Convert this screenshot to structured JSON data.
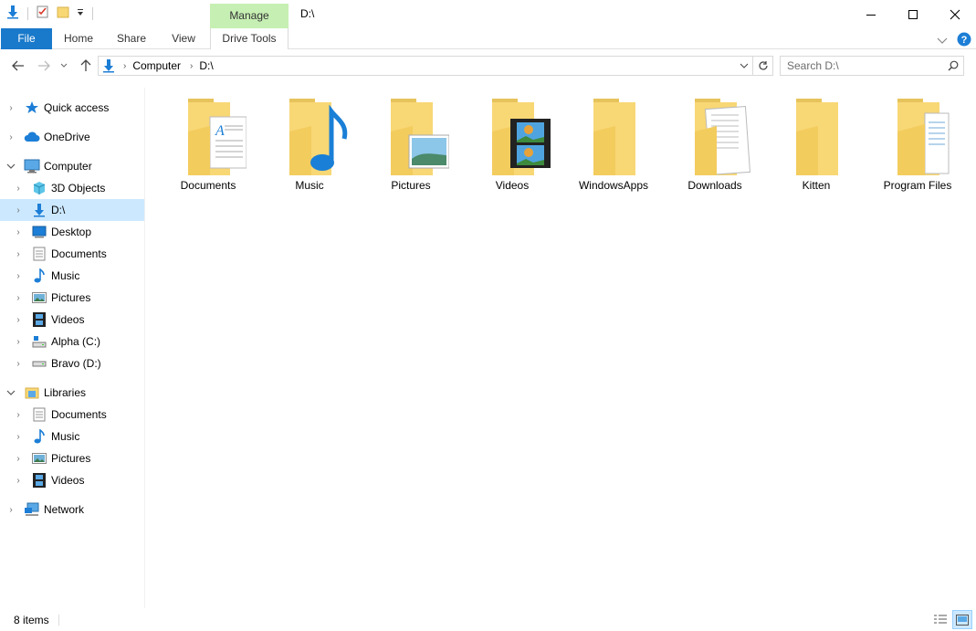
{
  "window": {
    "title": "D:\\",
    "context_tab": "Manage"
  },
  "ribbon": {
    "tabs": [
      "File",
      "Home",
      "Share",
      "View",
      "Drive Tools"
    ]
  },
  "address": {
    "crumbs": [
      "Computer",
      "D:\\"
    ]
  },
  "search": {
    "placeholder": "Search D:\\"
  },
  "nav": {
    "items": [
      {
        "label": "Quick access",
        "icon": "star-icon"
      },
      {
        "label": "OneDrive",
        "icon": "cloud-icon"
      },
      {
        "label": "Computer",
        "icon": "computer-icon"
      },
      {
        "label": "3D Objects",
        "icon": "cube-icon"
      },
      {
        "label": "D:\\",
        "icon": "download-arrow-icon"
      },
      {
        "label": "Desktop",
        "icon": "desktop-icon"
      },
      {
        "label": "Documents",
        "icon": "document-icon"
      },
      {
        "label": "Music",
        "icon": "music-note-icon"
      },
      {
        "label": "Pictures",
        "icon": "picture-icon"
      },
      {
        "label": "Videos",
        "icon": "film-icon"
      },
      {
        "label": "Alpha (C:)",
        "icon": "drive-c-icon"
      },
      {
        "label": "Bravo (D:)",
        "icon": "drive-d-icon"
      },
      {
        "label": "Libraries",
        "icon": "library-icon"
      },
      {
        "label": "Documents",
        "icon": "document-icon"
      },
      {
        "label": "Music",
        "icon": "music-note-icon"
      },
      {
        "label": "Pictures",
        "icon": "picture-icon"
      },
      {
        "label": "Videos",
        "icon": "film-icon"
      },
      {
        "label": "Network",
        "icon": "network-icon"
      }
    ]
  },
  "folders": [
    {
      "label": "Documents",
      "overlay": "document"
    },
    {
      "label": "Music",
      "overlay": "music"
    },
    {
      "label": "Pictures",
      "overlay": "picture"
    },
    {
      "label": "Videos",
      "overlay": "video"
    },
    {
      "label": "WindowsApps",
      "overlay": "none"
    },
    {
      "label": "Downloads",
      "overlay": "papers"
    },
    {
      "label": "Kitten",
      "overlay": "none"
    },
    {
      "label": "Program Files",
      "overlay": "papers2"
    }
  ],
  "status": {
    "item_count": "8 items"
  },
  "colors": {
    "accent": "#1979ca",
    "selection": "#cce8ff",
    "manage_tab": "#c6efb3",
    "folder": "#f8d775"
  }
}
